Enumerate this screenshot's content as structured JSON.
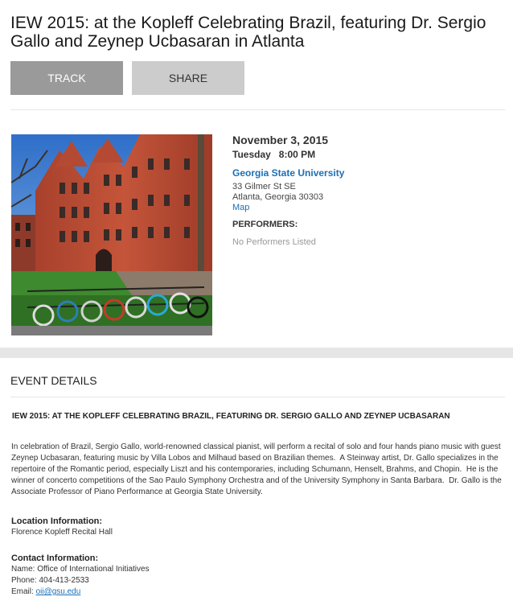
{
  "event": {
    "title": "IEW 2015: at the Kopleff Celebrating Brazil, featuring Dr. Sergio Gallo and Zeynep Ucbasaran in Atlanta",
    "title_upper": "IEW 2015: AT THE KOPLEFF CELEBRATING BRAZIL, FEATURING DR. SERGIO GALLO AND ZEYNEP UCBASARAN",
    "date": "November 3, 2015",
    "day_time": "Tuesday   8:00 PM"
  },
  "actions": {
    "track_label": "TRACK",
    "share_label": "SHARE"
  },
  "venue": {
    "name": "Georgia State University",
    "street": "33 Gilmer St SE",
    "city_line": "Atlanta, Georgia 30303",
    "map_label": "Map"
  },
  "performers": {
    "heading": "PERFORMERS:",
    "none_text": "No Performers Listed"
  },
  "details": {
    "heading": "EVENT DETAILS",
    "description": "In celebration of Brazil, Sergio Gallo, world-renowned classical pianist, will perform a recital of solo and four hands piano music with guest Zeynep Ucbasaran, featuring music by Villa Lobos and Milhaud based on Brazilian themes.  A Steinway artist, Dr. Gallo specializes in the repertoire of the Romantic period, especially Liszt and his contemporaries, including Schumann, Henselt, Brahms, and Chopin.  He is the winner of concerto competitions of the Sao Paulo Symphony Orchestra and of the University Symphony in Santa Barbara.  Dr. Gallo is the Associate Professor of Piano Performance at Georgia State University."
  },
  "location": {
    "heading": "Location Information:",
    "value": "Florence Kopleff Recital Hall"
  },
  "contact": {
    "heading": "Contact Information:",
    "name_line": "Name: Office of International Initiatives",
    "phone_line": "Phone: 404-413-2533",
    "email_label": "Email: ",
    "email": "oii@gsu.edu"
  },
  "colors": {
    "link": "#1b6fb5",
    "track_button": "#9a9a9a",
    "share_button": "#cccccc",
    "divider": "#e6e6e6"
  }
}
